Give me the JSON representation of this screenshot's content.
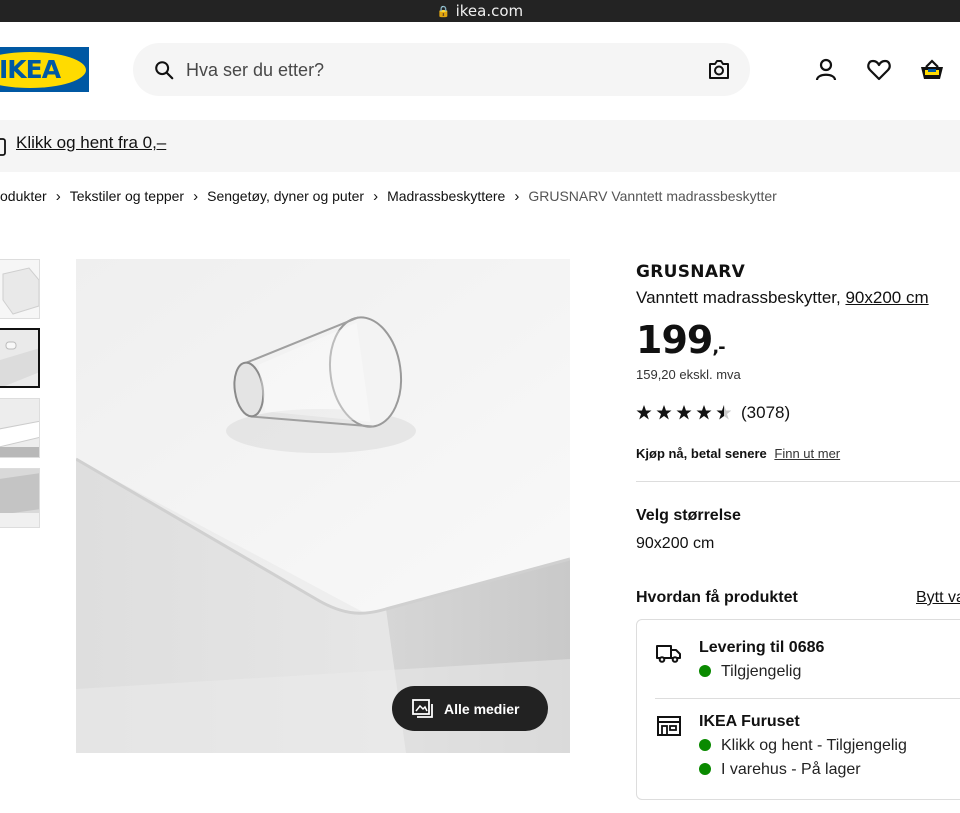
{
  "browser": {
    "url": "ikea.com"
  },
  "header": {
    "logo_text": "IKEA",
    "search_placeholder": "Hva ser du etter?"
  },
  "banner": {
    "link": "Klikk og hent fra 0,–"
  },
  "breadcrumb": [
    "Produkter",
    "Tekstiler og tepper",
    "Sengetøy, dyner og puter",
    "Madrassbeskyttere",
    "GRUSNARV Vanntett madrassbeskytter"
  ],
  "gallery": {
    "all_media_label": "Alle medier"
  },
  "product": {
    "name": "GRUSNARV",
    "description": "Vanntett madrassbeskytter,",
    "size_link": "90x200 cm",
    "price": "199",
    "price_suffix": ",-",
    "price_ex_vat": "159,20 ekskl. mva",
    "rating_count": "(3078)",
    "rating_value": 4.5,
    "pay_later": "Kjøp nå, betal senere",
    "pay_later_link": "Finn ut mer",
    "size_label": "Velg størrelse",
    "size_value": "90x200 cm"
  },
  "delivery": {
    "heading": "Hvordan få produktet",
    "change_link": "Bytt va",
    "delivery_title": "Levering til 0686",
    "delivery_status": "Tilgjengelig",
    "store_title": "IKEA Furuset",
    "store_status_1": "Klikk og hent - Tilgjengelig",
    "store_status_2": "I varehus - På lager",
    "status_color": "#0a8a00"
  }
}
